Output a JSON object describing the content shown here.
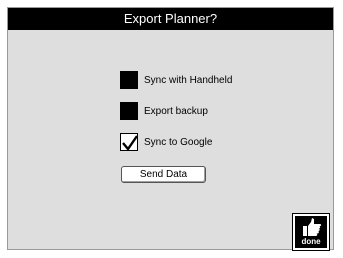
{
  "dialog": {
    "title": "Export Planner?"
  },
  "options": [
    {
      "label": "Sync with Handheld",
      "checked": false
    },
    {
      "label": "Export backup",
      "checked": false
    },
    {
      "label": "Sync to Google",
      "checked": true
    }
  ],
  "actions": {
    "send_label": "Send Data",
    "done_label": "done"
  },
  "icons": {
    "done": "thumbs-up-icon",
    "check": "checkmark-icon"
  },
  "colors": {
    "titlebar": "#000000",
    "dialog_background": "#dedede"
  }
}
